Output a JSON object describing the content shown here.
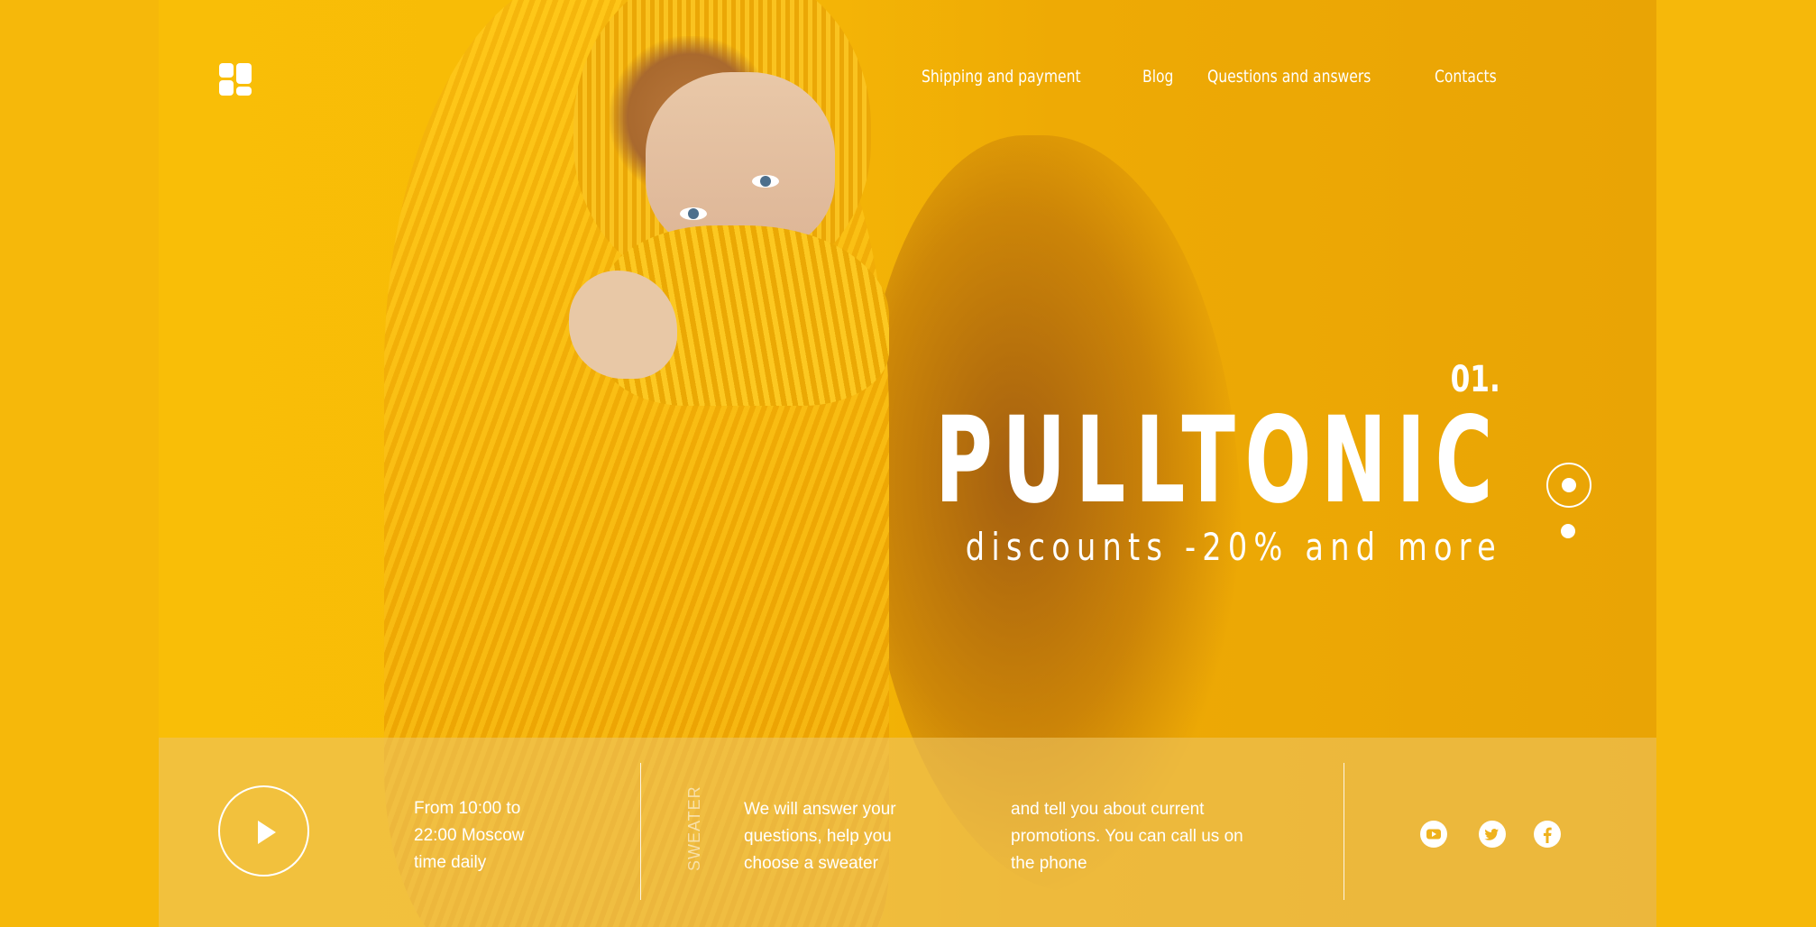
{
  "brand": {
    "logo_icon": "grid-logo-icon"
  },
  "nav": {
    "items": [
      {
        "label": "Shipping and payment"
      },
      {
        "label": "Blog"
      },
      {
        "label": "Questions and answers"
      },
      {
        "label": "Contacts"
      }
    ]
  },
  "hero": {
    "slide_number": "01.",
    "title": "PULLTONIC",
    "subtitle": "discounts -20% and more",
    "pager": {
      "total": 2,
      "active": 1
    }
  },
  "footer_bar": {
    "play_icon": "play-icon",
    "hours": "From 10:00 to 22:00 Moscow time daily",
    "vertical_label": "SWEATER",
    "info_part1": "We will answer your questions, help you choose a sweater",
    "info_part2": "and tell you about current promotions. You can call us on the phone",
    "social": [
      {
        "icon": "youtube-icon"
      },
      {
        "icon": "twitter-icon"
      },
      {
        "icon": "facebook-icon"
      }
    ]
  },
  "colors": {
    "accent": "#f6b80a",
    "text": "#ffffff"
  }
}
